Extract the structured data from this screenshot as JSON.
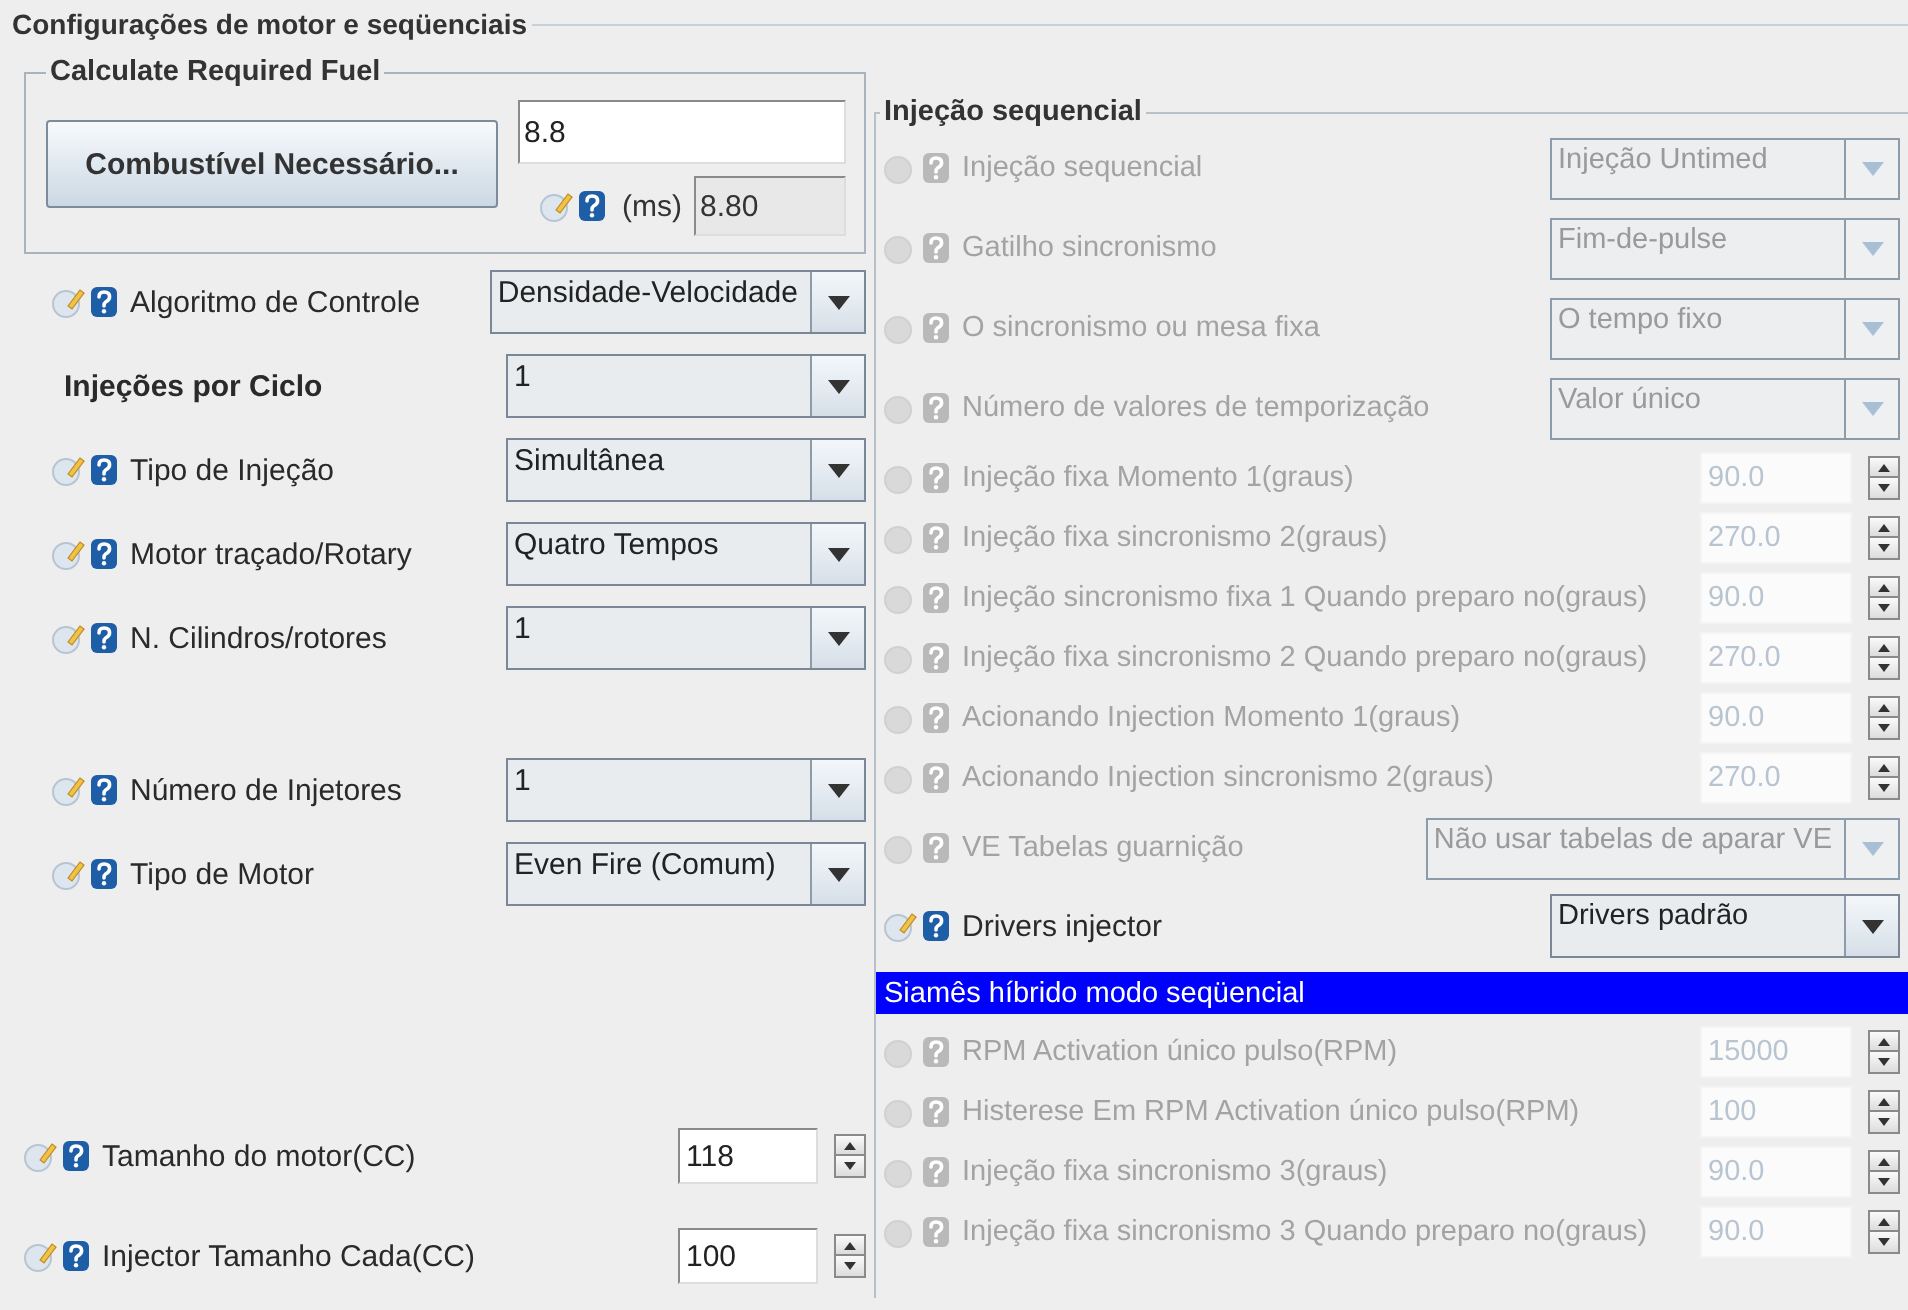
{
  "panel_title": "Configurações de motor e seqüenciais",
  "fuel": {
    "title": "Calculate Required Fuel",
    "button": "Combustível Necessário...",
    "value": "8.8",
    "unit": "(ms)",
    "result": "8.80"
  },
  "left_groups": [
    [
      {
        "kind": "select",
        "label": "Algoritmo de Controle",
        "value": "Densidade-Velocidade",
        "icons": true
      },
      {
        "kind": "select",
        "label": "Injeções por Ciclo",
        "value": "1",
        "icons": false
      },
      {
        "kind": "select",
        "label": "Tipo de Injeção",
        "value": "Simultânea",
        "icons": true
      },
      {
        "kind": "select",
        "label": "Motor traçado/Rotary",
        "value": "Quatro Tempos",
        "icons": true
      },
      {
        "kind": "select",
        "label": "N. Cilindros/rotores",
        "value": "1",
        "icons": true
      }
    ],
    [
      {
        "kind": "select",
        "label": "Número de Injetores",
        "value": "1",
        "icons": true
      },
      {
        "kind": "select",
        "label": "Tipo de Motor",
        "value": "Even Fire (Comum)",
        "icons": true
      }
    ],
    [
      {
        "kind": "spinner",
        "label": "Tamanho do motor(CC)",
        "value": "118",
        "icons": true
      },
      {
        "kind": "spinner",
        "label": "Injector Tamanho Cada(CC)",
        "value": "100",
        "icons": true
      }
    ]
  ],
  "right": {
    "title": "Injeção sequencial",
    "rows": [
      {
        "kind": "select",
        "label": "Injeção sequencial",
        "value": "Injeção Untimed",
        "disabled": true
      },
      {
        "kind": "select",
        "label": "Gatilho sincronismo",
        "value": "Fim-de-pulse",
        "disabled": true
      },
      {
        "kind": "select",
        "label": "O sincronismo ou mesa fixa",
        "value": "O tempo fixo",
        "disabled": true
      },
      {
        "kind": "select",
        "label": "Número de valores de temporização",
        "value": "Valor único",
        "disabled": true
      },
      {
        "kind": "spinner",
        "label": "Injeção fixa Momento 1(graus)",
        "value": "90.0",
        "disabled": true
      },
      {
        "kind": "spinner",
        "label": "Injeção fixa sincronismo 2(graus)",
        "value": "270.0",
        "disabled": true
      },
      {
        "kind": "spinner",
        "label": "Injeção sincronismo fixa 1 Quando preparo no(graus)",
        "value": "90.0",
        "disabled": true
      },
      {
        "kind": "spinner",
        "label": "Injeção fixa sincronismo 2 Quando preparo no(graus)",
        "value": "270.0",
        "disabled": true
      },
      {
        "kind": "spinner",
        "label": "Acionando Injection Momento 1(graus)",
        "value": "90.0",
        "disabled": true
      },
      {
        "kind": "spinner",
        "label": "Acionando Injection sincronismo 2(graus)",
        "value": "270.0",
        "disabled": true
      },
      {
        "kind": "select",
        "label": "VE Tabelas guarnição",
        "value": "Não usar tabelas de aparar VE",
        "disabled": true
      },
      {
        "kind": "select",
        "label": "Drivers injector",
        "value": "Drivers padrão",
        "disabled": false
      },
      {
        "kind": "header",
        "label": "Siamês híbrido modo seqüencial"
      },
      {
        "kind": "spinner",
        "label": "RPM Activation único pulso(RPM)",
        "value": "15000",
        "disabled": true
      },
      {
        "kind": "spinner",
        "label": "Histerese Em RPM Activation único pulso(RPM)",
        "value": "100",
        "disabled": true
      },
      {
        "kind": "spinner",
        "label": "Injeção fixa sincronismo 3(graus)",
        "value": "90.0",
        "disabled": true
      },
      {
        "kind": "spinner",
        "label": "Injeção fixa sincronismo 3 Quando preparo no(graus)",
        "value": "90.0",
        "disabled": true
      }
    ]
  }
}
